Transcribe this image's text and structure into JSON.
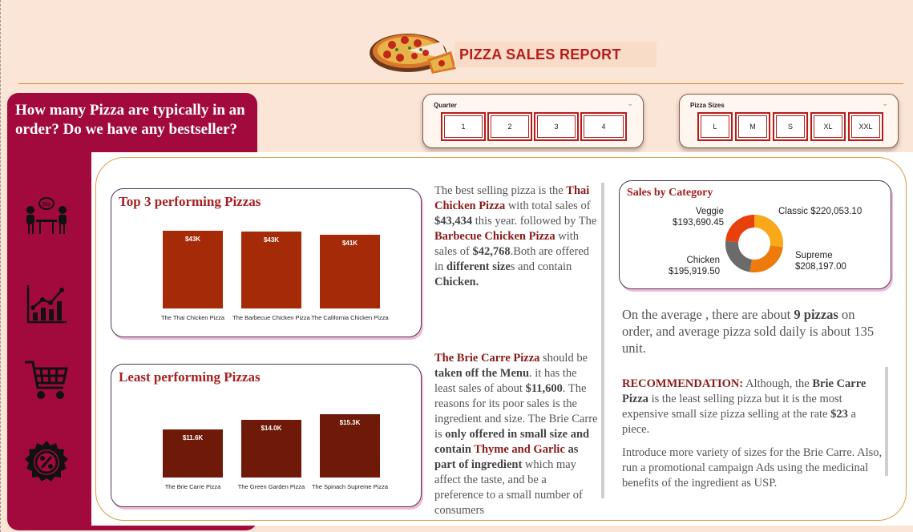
{
  "header": {
    "title": "PIZZA SALES REPORT",
    "logo": "pizza-logo"
  },
  "question": "How many Pizza are typically in an order? Do we have any bestseller?",
  "sidebar_icons": [
    "people-meeting-icon",
    "growth-chart-icon",
    "shopping-cart-icon",
    "discount-gear-icon"
  ],
  "slicers": {
    "quarter": {
      "title": "Quarter",
      "options": [
        "1",
        "2",
        "3",
        "4"
      ]
    },
    "sizes": {
      "title": "Pizza Sizes",
      "options": [
        "L",
        "M",
        "S",
        "XL",
        "XXL"
      ]
    }
  },
  "top3": {
    "title": "Top 3 performing Pizzas",
    "chart_data": {
      "type": "bar",
      "categories": [
        "The Thai Chicken Pizza",
        "The Barbecue Chicken Pizza",
        "The California Chicken Pizza"
      ],
      "values": [
        43434,
        42768,
        41410
      ],
      "data_labels": [
        "$43K",
        "$43K",
        "$41K"
      ],
      "color": "#a52a08"
    }
  },
  "least": {
    "title": "Least performing Pizzas",
    "chart_data": {
      "type": "bar",
      "categories": [
        "The Brie Carre Pizza",
        "The Green Garden Pizza",
        "The Spinach Supreme Pizza"
      ],
      "values": [
        11600,
        14000,
        15300
      ],
      "data_labels": [
        "$11.6K",
        "$14.0K",
        "$15.3K"
      ],
      "color": "#6f1a08"
    }
  },
  "text_best": [
    {
      "t": "The best selling pizza is the "
    },
    {
      "t": "Thai Chicken Pizza",
      "s": "red"
    },
    {
      "t": " with total sales of "
    },
    {
      "t": "$43,434",
      "s": "b"
    },
    {
      "t": " this year. followed by The "
    },
    {
      "t": "Barbecue Chicken Pizza",
      "s": "red"
    },
    {
      "t": " with sales of "
    },
    {
      "t": "$42,768",
      "s": "b"
    },
    {
      "t": ".Both are offered in "
    },
    {
      "t": "different size",
      "s": "b"
    },
    {
      "t": "s and contain "
    },
    {
      "t": "Chicken.",
      "s": "b"
    }
  ],
  "text_least": [
    {
      "t": "The Brie Carre Pizza",
      "s": "red"
    },
    {
      "t": " should be "
    },
    {
      "t": "taken off the Menu",
      "s": "b"
    },
    {
      "t": ". it has the least sales of about "
    },
    {
      "t": "$11,600",
      "s": "b"
    },
    {
      "t": ". The reasons for its poor sales is the ingredient and size. The Brie Carre is "
    },
    {
      "t": "only offered in small size and contain ",
      "s": "b"
    },
    {
      "t": "Thyme and Garlic",
      "s": "red"
    },
    {
      "t": " as part of ingredient",
      "s": "b"
    },
    {
      "t": " which may affect the taste, and be a preference to a small number of consumers"
    }
  ],
  "category": {
    "title": "Sales by Category",
    "chart_data": {
      "type": "pie",
      "categories": [
        "Classic",
        "Supreme",
        "Chicken",
        "Veggie"
      ],
      "values": [
        220053.1,
        208197.0,
        195919.5,
        193690.45
      ],
      "labels": [
        "$220,053.10",
        "$208,197.00",
        "$195,919.50",
        "$193,690.45"
      ],
      "colors": [
        "#f7a81b",
        "#ec7b0c",
        "#6b6b6b",
        "#e8400c"
      ]
    }
  },
  "average_text": [
    {
      "t": "On the average , there are about "
    },
    {
      "t": "9 pizzas",
      "s": "b"
    },
    {
      "t": " on order, and average pizza sold daily is about 135 unit."
    }
  ],
  "recommendation": [
    {
      "t": "RECOMMENDATION:",
      "s": "red"
    },
    {
      "t": " Although, the "
    },
    {
      "t": "Brie Carre Pizza",
      "s": "b"
    },
    {
      "t": " is the least selling pizza but it is the most expensive small size pizza selling at the rate "
    },
    {
      "t": "$23",
      "s": "b"
    },
    {
      "t": " a piece."
    }
  ],
  "recommendation2": "Introduce more variety of sizes for the Brie Carre. Also, run a promotional campaign Ads using the medicinal benefits of the ingredient as USP."
}
